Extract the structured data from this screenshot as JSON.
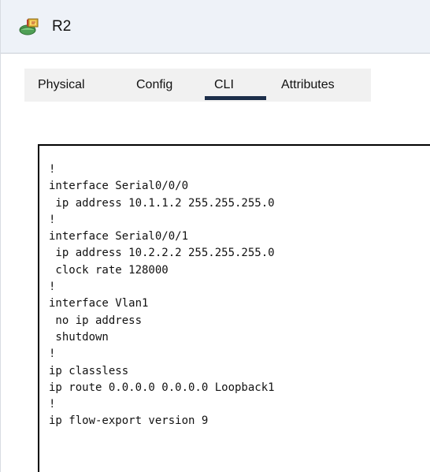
{
  "window": {
    "title": "R2",
    "icon": "router-icon"
  },
  "tabs": [
    {
      "label": "Physical",
      "active": false
    },
    {
      "label": "Config",
      "active": false
    },
    {
      "label": "CLI",
      "active": true
    },
    {
      "label": "Attributes",
      "active": false
    }
  ],
  "cli": {
    "lines": [
      "!",
      "interface Serial0/0/0",
      " ip address 10.1.1.2 255.255.255.0",
      "!",
      "interface Serial0/0/1",
      " ip address 10.2.2.2 255.255.255.0",
      " clock rate 128000",
      "!",
      "interface Vlan1",
      " no ip address",
      " shutdown",
      "!",
      "ip classless",
      "ip route 0.0.0.0 0.0.0.0 Loopback1",
      "!",
      "ip flow-export version 9"
    ]
  },
  "colors": {
    "titlebar": "#eef2f8",
    "tab_strip": "#f1f1f1",
    "active_tab_underline": "#1c2e4a"
  }
}
